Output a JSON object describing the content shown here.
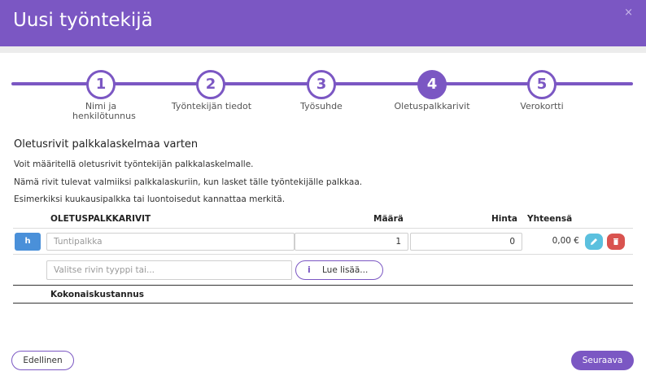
{
  "header": {
    "title": "Uusi työntekijä",
    "close_label": "×"
  },
  "stepper": {
    "steps": [
      {
        "number": "1",
        "label": "Nimi ja henkilötunnus"
      },
      {
        "number": "2",
        "label": "Työntekijän tiedot"
      },
      {
        "number": "3",
        "label": "Työsuhde"
      },
      {
        "number": "4",
        "label": "Oletuspalkkarivit"
      },
      {
        "number": "5",
        "label": "Verokortti"
      }
    ],
    "active_step": "4"
  },
  "section": {
    "title": "Oletusrivit palkkalaskelmaa varten",
    "paragraphs": [
      "Voit määritellä oletusrivit työntekijän palkkalaskelmalle.",
      "Nämä rivit tulevat valmiiksi palkkalaskuriin, kun lasket tälle työntekijälle palkkaa.",
      "Esimerkiksi kuukausipalkka tai luontoisedut kannattaa merkitä."
    ]
  },
  "table": {
    "headers": {
      "name": "OLETUSPALKKARIVIT",
      "qty": "Määrä",
      "price": "Hinta",
      "total": "Yhteensä"
    },
    "rows": [
      {
        "type_badge": "h",
        "name_placeholder": "Tuntipalkka",
        "qty": "1",
        "price": "0",
        "total": "0,00 €"
      }
    ],
    "new_row_placeholder": "Valitse rivin tyyppi tai...",
    "read_more_label": "Lue lisää...",
    "footer_label": "Kokonaiskustannus"
  },
  "footer": {
    "prev_label": "Edellinen",
    "next_label": "Seuraava"
  },
  "colors": {
    "accent": "#7b57c3",
    "badge_blue": "#4a90d9",
    "edit": "#5bc0de",
    "delete": "#d9534f"
  },
  "icons": {
    "edit": "pencil-icon",
    "delete": "trash-icon",
    "info": "info-icon",
    "close": "close-icon"
  }
}
